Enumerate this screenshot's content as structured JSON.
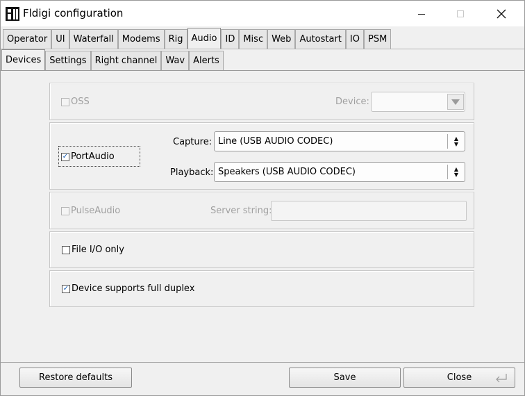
{
  "window": {
    "title": "Fldigi configuration",
    "controls": {
      "minimize": "—",
      "maximize": "☐",
      "close": "✕"
    }
  },
  "tabs_primary": [
    {
      "label": "Operator"
    },
    {
      "label": "UI"
    },
    {
      "label": "Waterfall"
    },
    {
      "label": "Modems"
    },
    {
      "label": "Rig"
    },
    {
      "label": "Audio",
      "active": true
    },
    {
      "label": "ID"
    },
    {
      "label": "Misc"
    },
    {
      "label": "Web"
    },
    {
      "label": "Autostart"
    },
    {
      "label": "IO"
    },
    {
      "label": "PSM"
    }
  ],
  "tabs_secondary": [
    {
      "label": "Devices",
      "active": true
    },
    {
      "label": "Settings"
    },
    {
      "label": "Right channel"
    },
    {
      "label": "Wav"
    },
    {
      "label": "Alerts"
    }
  ],
  "oss": {
    "label": "OSS",
    "checked": false,
    "enabled": false,
    "device_label": "Device:",
    "device_value": ""
  },
  "portaudio": {
    "label": "PortAudio",
    "checked": true,
    "capture_label": "Capture:",
    "capture_value": "Line (USB AUDIO  CODEC)",
    "playback_label": "Playback:",
    "playback_value": "Speakers (USB AUDIO  CODEC)"
  },
  "pulseaudio": {
    "label": "PulseAudio",
    "checked": false,
    "enabled": false,
    "server_label": "Server string:",
    "server_value": ""
  },
  "file_io": {
    "label": "File I/O only",
    "checked": false
  },
  "full_duplex": {
    "label": "Device supports full duplex",
    "checked": true
  },
  "buttons": {
    "restore": "Restore defaults",
    "save": "Save",
    "close": "Close"
  },
  "colors": {
    "accent_check": "#1a5fb4",
    "window_bg": "#f0f0f0"
  }
}
